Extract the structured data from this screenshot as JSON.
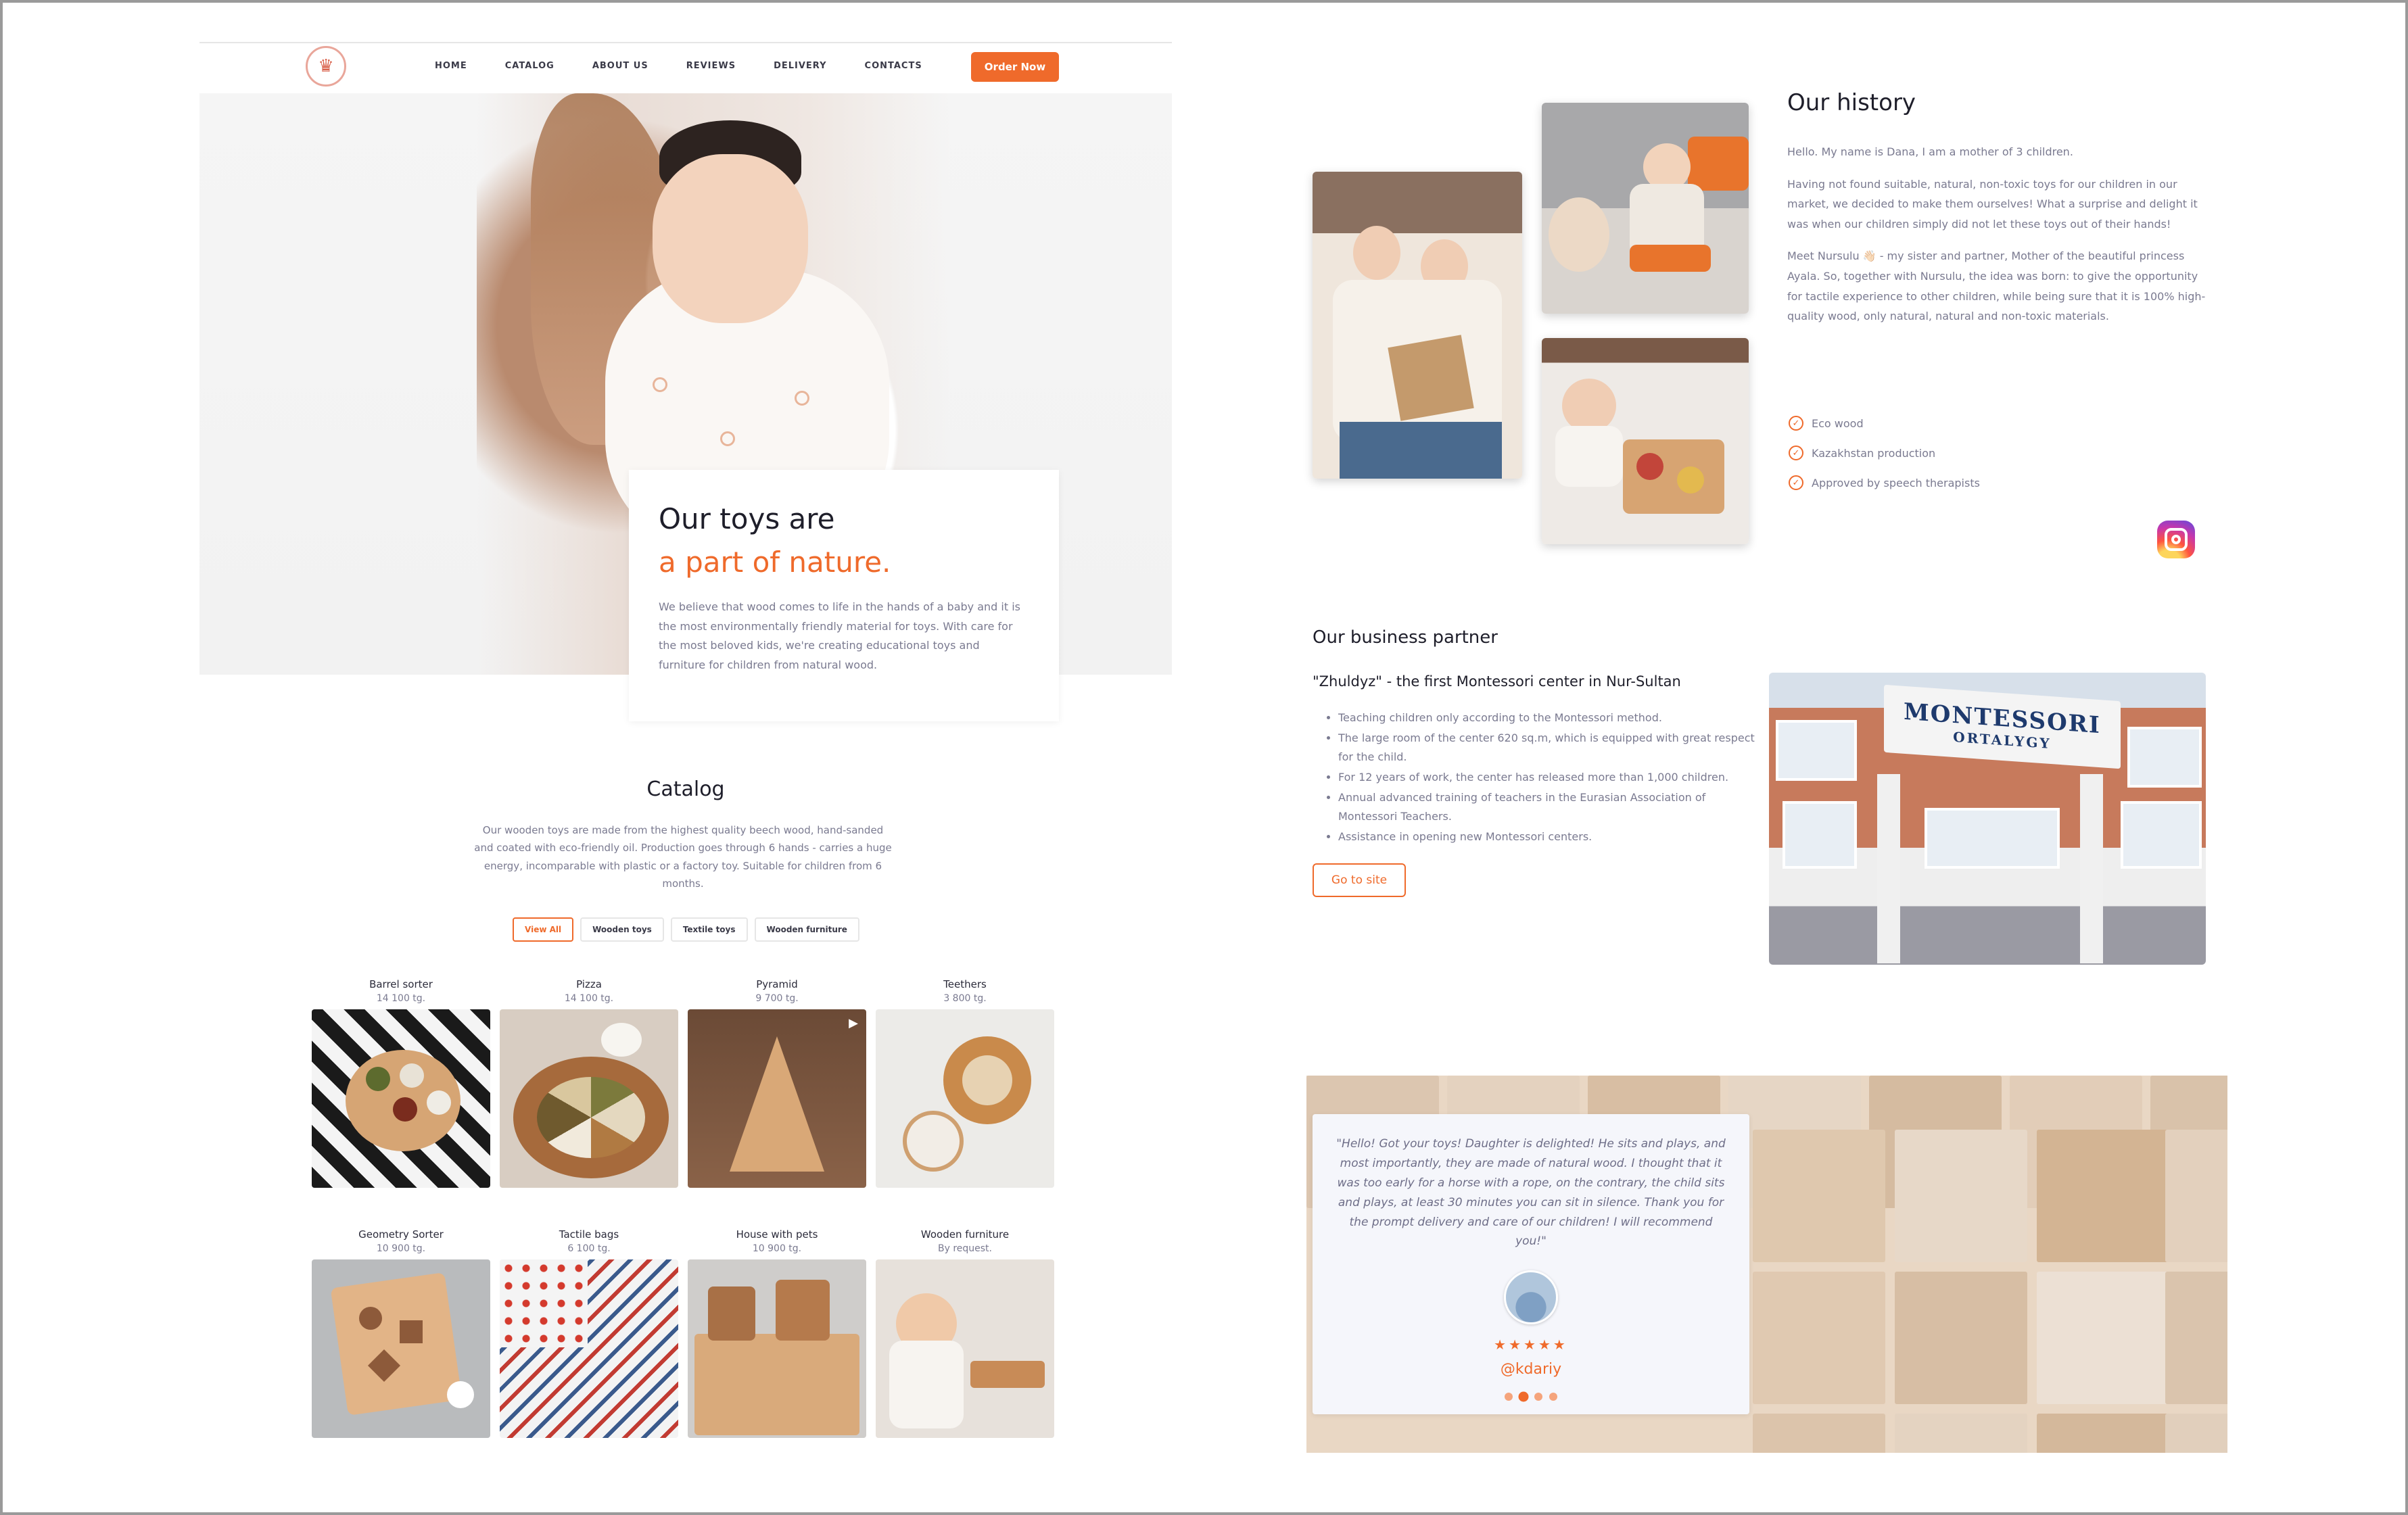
{
  "nav": {
    "links": [
      "HOME",
      "CATALOG",
      "ABOUT US",
      "REVIEWS",
      "DELIVERY",
      "CONTACTS"
    ],
    "order_button": "Order Now",
    "logo_icon": "crown-logo-icon"
  },
  "hero": {
    "line1": "Our toys are",
    "line2": "a part of nature.",
    "text": "We believe that wood comes to life in the hands of a baby and it is the most environmentally friendly material for toys. With care for the most beloved kids, we're creating educational toys and furniture for children from natural wood."
  },
  "catalog": {
    "title": "Catalog",
    "description": "Our wooden toys are made from the highest quality beech wood, hand-sanded and coated with eco-friendly oil. Production goes through 6 hands - carries a huge energy, incomparable with plastic or a factory toy. Suitable for children from 6 months.",
    "filters": [
      "View All",
      "Wooden toys",
      "Textile toys",
      "Wooden furniture"
    ],
    "active_filter": "View All",
    "products": [
      {
        "name": "Barrel sorter",
        "price": "14 100 tg."
      },
      {
        "name": "Pizza",
        "price": "14 100 tg."
      },
      {
        "name": "Pyramid",
        "price": "9 700 tg."
      },
      {
        "name": "Teethers",
        "price": "3 800 tg."
      },
      {
        "name": "Geometry Sorter",
        "price": "10 900 tg."
      },
      {
        "name": "Tactile bags",
        "price": "6 100 tg."
      },
      {
        "name": "House with pets",
        "price": "10 900 tg."
      },
      {
        "name": "Wooden furniture",
        "price": "By request."
      }
    ]
  },
  "history": {
    "title": "Our history",
    "paragraphs": [
      "Hello. My name is Dana, I am a mother of 3 children.",
      "Having not found suitable, natural, non-toxic toys for our children in our market, we decided to make them ourselves! What a surprise and delight it was when our children simply did not let these toys out of their hands!",
      "Meet Nursulu 👋🏻 - my sister and partner, Mother of the beautiful princess Ayala. So, together with Nursulu, the idea was born: to give the opportunity for tactile experience to other children, while being sure that it is 100% high-quality wood, only natural, natural and non-toxic materials."
    ],
    "features": [
      "Eco wood",
      "Kazakhstan production",
      "Approved by speech therapists"
    ]
  },
  "partner": {
    "title": "Our business partner",
    "subtitle": "\"Zhuldyz\" - the first Montessori center in Nur-Sultan",
    "items": [
      "Teaching children only according to the Montessori method.",
      "The large room of the center 620 sq.m, which is equipped with great respect for the child.",
      "For 12 years of work, the center has released more than 1,000 children.",
      "Annual advanced training of teachers in the Eurasian Association of Montessori Teachers.",
      "Assistance in opening new Montessori centers."
    ],
    "button": "Go to site",
    "sign_line1": "MONTESSORI",
    "sign_line2": "ORTALYGY"
  },
  "review": {
    "text": "\"Hello! Got your toys! Daughter is delighted! He sits and plays, and most importantly, they are made of natural wood. I thought that it was too early for a horse with a rope, on the contrary, the child sits and plays, at least 30 minutes you can sit in silence. Thank you for the prompt delivery and care of our children! I will recommend you!\"",
    "stars": "★★★★★",
    "handle": "@kdariy",
    "rating": 5,
    "slides": 4,
    "active_slide": 2
  },
  "colors": {
    "accent": "#ef6a2b",
    "text_muted": "#7a7a90",
    "heading": "#1e1e2a"
  }
}
